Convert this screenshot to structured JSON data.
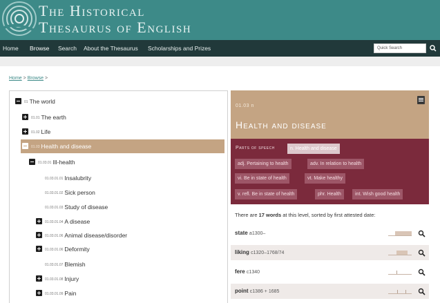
{
  "header": {
    "title_line1": "The Historical",
    "title_line2": "Thesaurus of English",
    "brand_color": "#3d8a88"
  },
  "nav": {
    "items": [
      "Home",
      "Browse",
      "Search",
      "About the Thesaurus",
      "Scholarships and Prizes"
    ],
    "active": "Browse",
    "search_placeholder": "Quick Search",
    "search_icon": "search-icon"
  },
  "breadcrumb": {
    "home": "Home",
    "browse": "Browse",
    "sep": ">"
  },
  "tree": [
    {
      "code": "01",
      "label": "The world",
      "toggle": "minus"
    },
    {
      "code": "01.01",
      "label": "The earth",
      "toggle": "plus"
    },
    {
      "code": "01.02",
      "label": "Life",
      "toggle": "plus"
    },
    {
      "code": "01.03",
      "label": "Health and disease",
      "toggle": "minus",
      "selected": true
    },
    {
      "code": "01.03.01",
      "label": "Ill-health",
      "toggle": "minus"
    },
    {
      "code": "01.03.01.01",
      "label": "Insalubrity",
      "toggle": "none"
    },
    {
      "code": "01.03.01.02",
      "label": "Sick person",
      "toggle": "none"
    },
    {
      "code": "01.03.01.03",
      "label": "Study of disease",
      "toggle": "none"
    },
    {
      "code": "01.03.01.04",
      "label": "A disease",
      "toggle": "plus"
    },
    {
      "code": "01.03.01.06",
      "label": "Animal disease/disorder",
      "toggle": "plus"
    },
    {
      "code": "01.03.01.06",
      "label": "Deformity",
      "toggle": "plus"
    },
    {
      "code": "01.03.01.07",
      "label": "Blemish",
      "toggle": "none"
    },
    {
      "code": "01.03.01.08",
      "label": "Injury",
      "toggle": "plus"
    },
    {
      "code": "01.03.01.09",
      "label": "Pain",
      "toggle": "plus"
    }
  ],
  "category": {
    "code": "01.03 n",
    "title": "Health and disease",
    "color": "#c4a483"
  },
  "parts_of_speech": {
    "label": "Parts of speech",
    "chips": [
      {
        "text": "n. Health and disease",
        "active": true
      },
      {
        "text": "adj. Pertaining to health"
      },
      {
        "text": "adv. In relation to health"
      },
      {
        "text": "vi. Be in state of health"
      },
      {
        "text": "vt. Make healthy"
      },
      {
        "text": "v. refl. Be in state of health"
      },
      {
        "text": "phr. Health"
      },
      {
        "text": "int. Wish good health"
      }
    ],
    "color": "#7b2a3c"
  },
  "words": {
    "summary_prefix": "There are ",
    "count": "17 words",
    "summary_suffix": " at this level, sorted by first attested date:",
    "items": [
      {
        "lemma": "state",
        "date": "a1300–"
      },
      {
        "lemma": "liking",
        "date": "c1320–1768/74"
      },
      {
        "lemma": "fere",
        "date": "c1340"
      },
      {
        "lemma": "point",
        "date": "c1386 + 1685"
      }
    ]
  }
}
